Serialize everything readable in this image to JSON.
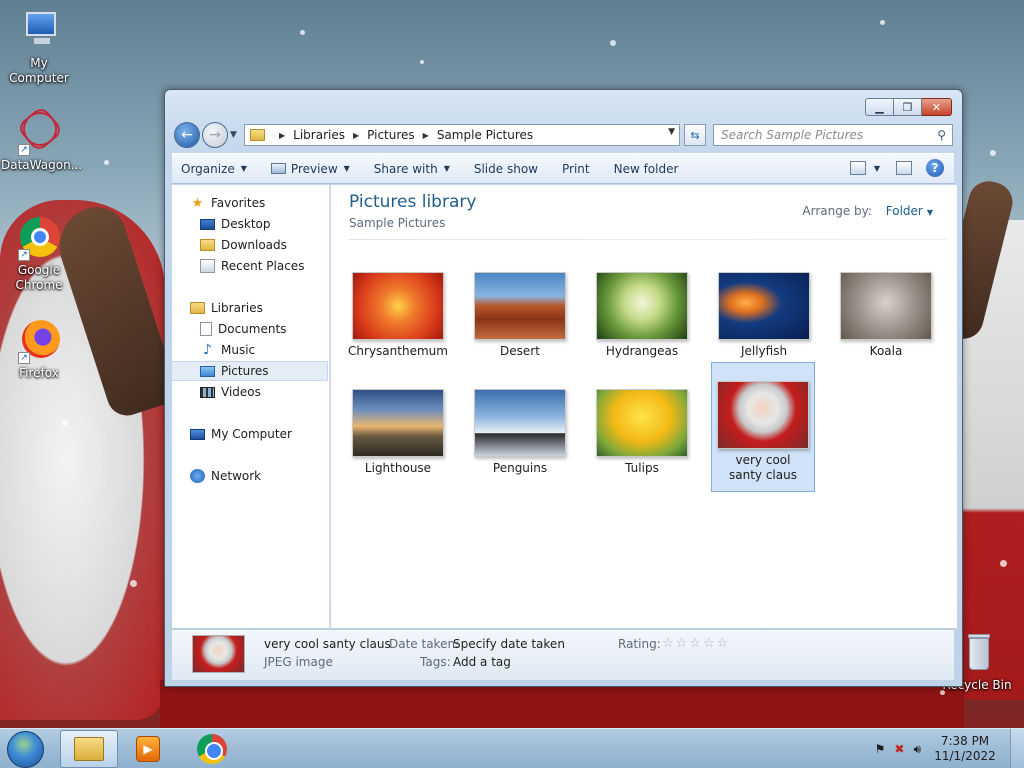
{
  "desktop": {
    "icons": [
      {
        "label": "My Computer",
        "icon": "computer-icon"
      },
      {
        "label": "DataWagon...",
        "icon": "datawagon-icon"
      },
      {
        "label": "Google Chrome",
        "icon": "chrome-icon"
      },
      {
        "label": "Firefox",
        "icon": "firefox-icon"
      },
      {
        "label": "Recycle Bin",
        "icon": "recycle-bin-icon"
      }
    ]
  },
  "window": {
    "caption_buttons": {
      "minimize": "▁",
      "maximize": "❐",
      "close": "✕"
    },
    "address": {
      "crumbs": [
        "Libraries",
        "Pictures",
        "Sample Pictures"
      ]
    },
    "search": {
      "placeholder": "Search Sample Pictures"
    },
    "toolbar": {
      "organize": "Organize",
      "preview": "Preview",
      "share_with": "Share with",
      "slide_show": "Slide show",
      "print": "Print",
      "new_folder": "New folder"
    },
    "nav": {
      "favorites": "Favorites",
      "desktop": "Desktop",
      "downloads": "Downloads",
      "recent_places": "Recent Places",
      "libraries": "Libraries",
      "documents": "Documents",
      "music": "Music",
      "pictures": "Pictures",
      "videos": "Videos",
      "my_computer": "My Computer",
      "network": "Network"
    },
    "content": {
      "title": "Pictures library",
      "subtitle": "Sample Pictures",
      "arrange_label": "Arrange by:",
      "arrange_value": "Folder",
      "items": [
        {
          "label": "Chrysanthemum"
        },
        {
          "label": "Desert"
        },
        {
          "label": "Hydrangeas"
        },
        {
          "label": "Jellyfish"
        },
        {
          "label": "Koala"
        },
        {
          "label": "Lighthouse"
        },
        {
          "label": "Penguins"
        },
        {
          "label": "Tulips"
        },
        {
          "label": "very cool santy claus",
          "selected": true
        }
      ]
    },
    "details": {
      "name": "very cool santy claus",
      "type": "JPEG image",
      "date_taken_label": "Date taken:",
      "date_taken_value": "Specify date taken",
      "tags_label": "Tags:",
      "tags_value": "Add a tag",
      "rating_label": "Rating:",
      "rating": "☆☆☆☆☆"
    }
  },
  "taskbar": {
    "time": "7:38 PM",
    "date": "11/1/2022"
  },
  "colors": {
    "accent": "#1e5e8c",
    "selection": "#cfe2f8",
    "taskbar": "#9dbcd6"
  }
}
